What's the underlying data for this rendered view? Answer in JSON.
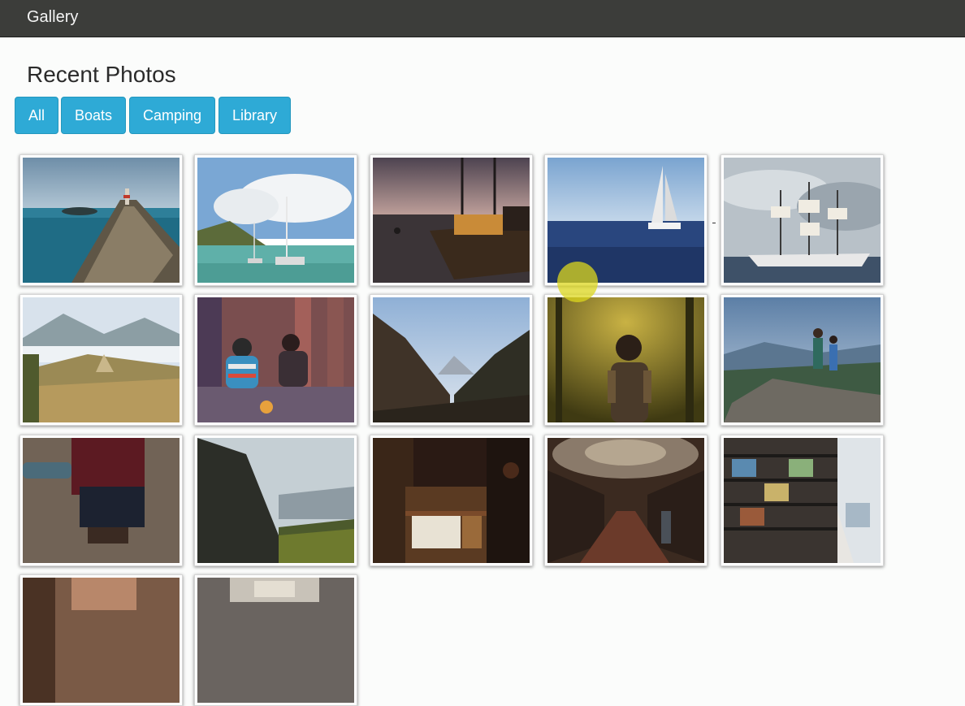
{
  "header": {
    "brand": "Gallery"
  },
  "main": {
    "title": "Recent Photos",
    "filters": [
      {
        "label": "All"
      },
      {
        "label": "Boats"
      },
      {
        "label": "Camping"
      },
      {
        "label": "Library"
      }
    ],
    "photos": [
      {
        "category": "Boats",
        "subject": "longtail boat bow at sea"
      },
      {
        "category": "Boats",
        "subject": "sailboats in turquoise bay"
      },
      {
        "category": "Boats",
        "subject": "wooden boat at dusk"
      },
      {
        "category": "Boats",
        "subject": "sailboat on open sea"
      },
      {
        "category": "Boats",
        "subject": "tall ship under cloudy sky"
      },
      {
        "category": "Camping",
        "subject": "tent in misty mountains"
      },
      {
        "category": "Camping",
        "subject": "two campers by campfire"
      },
      {
        "category": "Camping",
        "subject": "forested mountain valley"
      },
      {
        "category": "Camping",
        "subject": "hiker in forest sunlight"
      },
      {
        "category": "Camping",
        "subject": "couple on rocky summit"
      },
      {
        "category": "Camping",
        "subject": "camper pouring thermos"
      },
      {
        "category": "Camping",
        "subject": "cliff and valley view"
      },
      {
        "category": "Library",
        "subject": "dark bookshelf"
      },
      {
        "category": "Library",
        "subject": "baroque library hall"
      },
      {
        "category": "Library",
        "subject": "modern library aisle"
      },
      {
        "category": "Library",
        "subject": "library shelves"
      },
      {
        "category": "Library",
        "subject": "library interior"
      }
    ]
  }
}
